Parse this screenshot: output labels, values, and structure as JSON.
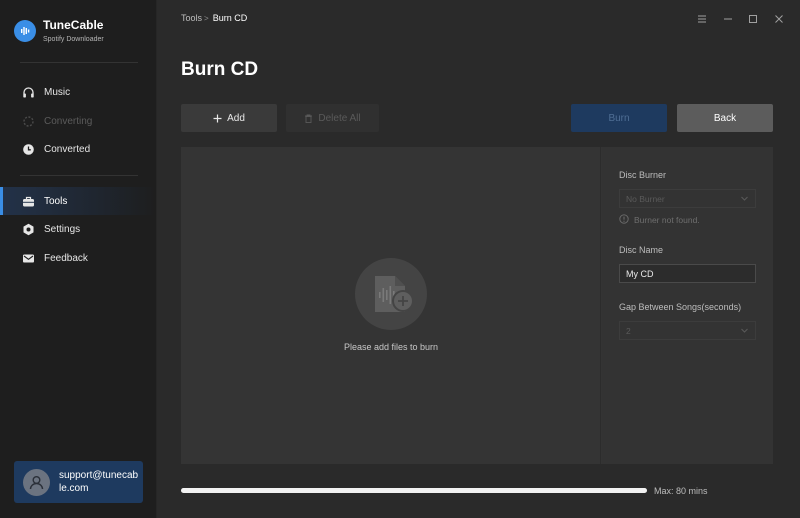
{
  "brand": {
    "name": "TuneCable",
    "subtitle": "Spotify Downloader"
  },
  "sidebar": {
    "items": [
      {
        "label": "Music",
        "icon": "headphones-icon",
        "state": "normal"
      },
      {
        "label": "Converting",
        "icon": "loading-icon",
        "state": "disabled"
      },
      {
        "label": "Converted",
        "icon": "clock-icon",
        "state": "normal"
      },
      {
        "label": "Tools",
        "icon": "toolbox-icon",
        "state": "active"
      },
      {
        "label": "Settings",
        "icon": "gear-icon",
        "state": "normal"
      },
      {
        "label": "Feedback",
        "icon": "mail-icon",
        "state": "normal"
      }
    ]
  },
  "account": {
    "email": "support@tunecable.com"
  },
  "breadcrumb": {
    "parent": "Tools",
    "separator": ">",
    "current": "Burn CD"
  },
  "page": {
    "title": "Burn CD"
  },
  "toolbar": {
    "add_label": "Add",
    "delete_all_label": "Delete All",
    "burn_label": "Burn",
    "back_label": "Back"
  },
  "drop_zone": {
    "hint": "Please add files to burn"
  },
  "settings": {
    "disc_burner_label": "Disc Burner",
    "disc_burner_value": "No Burner",
    "burner_warning": "Burner not found.",
    "disc_name_label": "Disc Name",
    "disc_name_value": "My CD",
    "gap_label": "Gap Between Songs(seconds)",
    "gap_value": "2"
  },
  "capacity": {
    "used_fraction": 1.0,
    "label": "Max: 80 mins"
  },
  "colors": {
    "accent": "#3a8ee6",
    "active_bg": "#1e3a5f",
    "background": "#2a2a2a",
    "sidebar": "#1e1e1e"
  }
}
